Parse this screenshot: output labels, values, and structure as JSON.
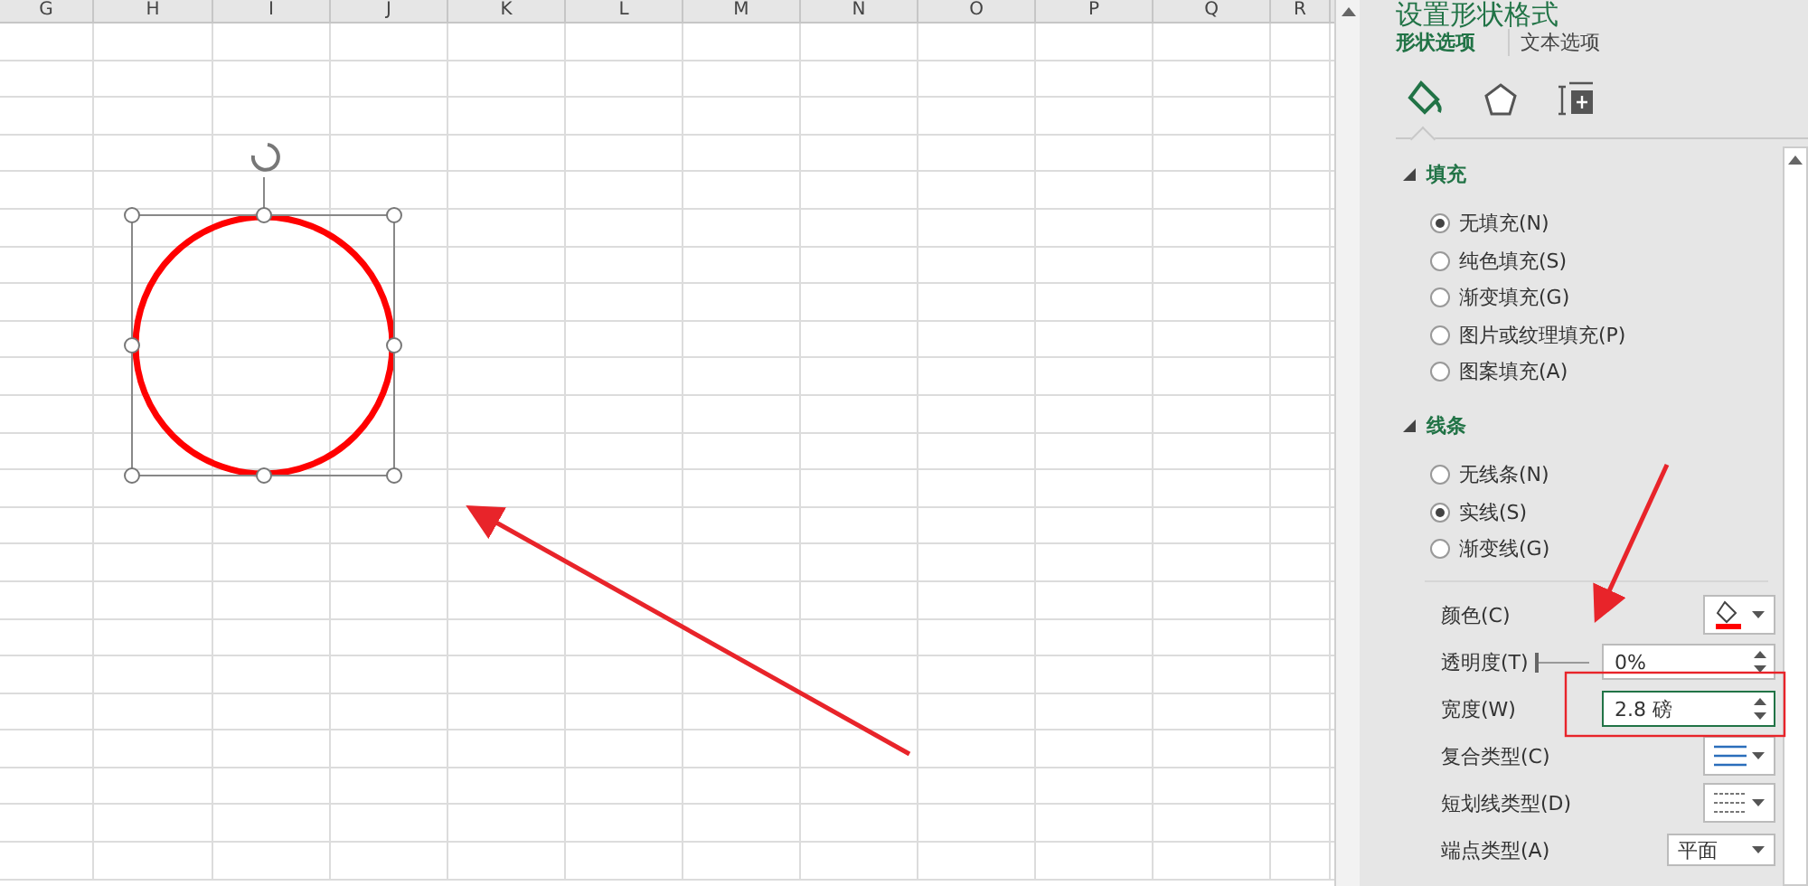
{
  "sheet": {
    "columns": [
      "G",
      "H",
      "I",
      "J",
      "K",
      "L",
      "M",
      "N",
      "O",
      "P",
      "Q",
      "R"
    ],
    "shape": {
      "kind": "circle",
      "selected": true
    }
  },
  "panel": {
    "title": "设置形状格式",
    "tabs": [
      {
        "label": "形状选项",
        "selected": true
      },
      {
        "label": "文本选项",
        "selected": false
      }
    ],
    "icon_tabs": [
      {
        "kind": "fill",
        "selected": true
      },
      {
        "kind": "effects",
        "selected": false
      },
      {
        "kind": "size",
        "selected": false
      }
    ],
    "sections": [
      {
        "title": "填充",
        "expanded": true,
        "options": [
          {
            "label": "无填充(N)",
            "selected": true
          },
          {
            "label": "纯色填充(S)",
            "selected": false
          },
          {
            "label": "渐变填充(G)",
            "selected": false
          },
          {
            "label": "图片或纹理填充(P)",
            "selected": false
          },
          {
            "label": "图案填充(A)",
            "selected": false
          }
        ]
      },
      {
        "title": "线条",
        "expanded": true,
        "options": [
          {
            "label": "无线条(N)",
            "selected": false
          },
          {
            "label": "实线(S)",
            "selected": true
          },
          {
            "label": "渐变线(G)",
            "selected": false
          }
        ],
        "properties": [
          {
            "kind": "color",
            "label": "颜色(C)"
          },
          {
            "kind": "slider",
            "label": "透明度(T)",
            "value": "0%",
            "level": 0
          },
          {
            "kind": "spin",
            "label": "宽度(W)",
            "value": "2.8 磅"
          },
          {
            "kind": "compound",
            "label": "复合类型(C)"
          },
          {
            "kind": "dash",
            "label": "短划线类型(D)"
          },
          {
            "kind": "dropdown",
            "label": "端点类型(A)",
            "value": "平面"
          }
        ]
      }
    ]
  }
}
